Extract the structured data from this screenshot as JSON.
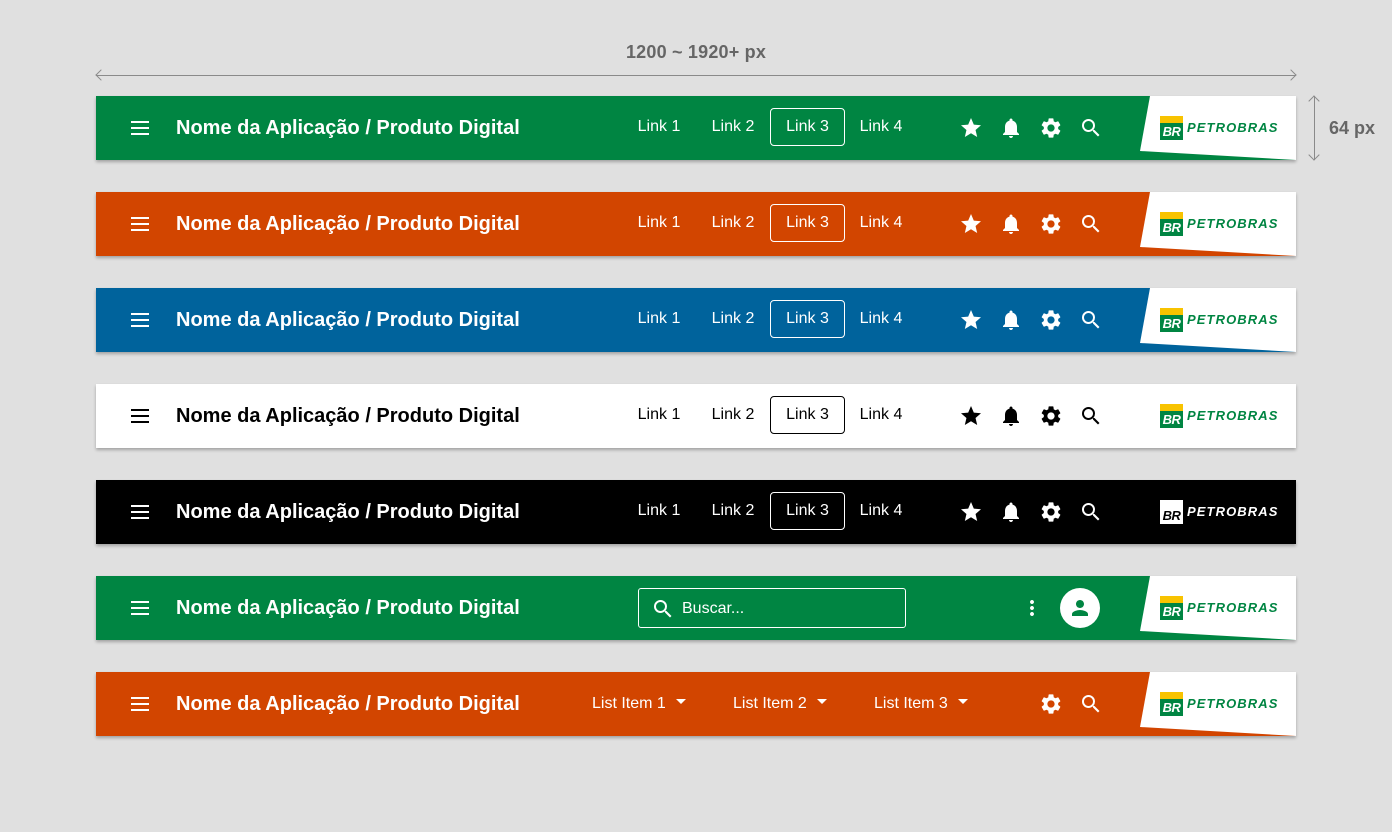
{
  "dimensions": {
    "width_label": "1200 ~ 1920+ px",
    "height_label": "64 px"
  },
  "shared": {
    "title": "Nome da Aplicação / Produto Digital",
    "links": [
      "Link 1",
      "Link 2",
      "Link 3",
      "Link 4"
    ],
    "active_link": "Link 3",
    "logo_br": "BR",
    "logo_word": "PETROBRAS"
  },
  "bars": [
    {
      "variant": "links",
      "background": "#008542",
      "foreground": "#ffffff",
      "logo_style": "white-tab"
    },
    {
      "variant": "links",
      "background": "#d24500",
      "foreground": "#ffffff",
      "logo_style": "white-tab"
    },
    {
      "variant": "links",
      "background": "#00639c",
      "foreground": "#ffffff",
      "logo_style": "white-tab"
    },
    {
      "variant": "links",
      "background": "#ffffff",
      "foreground": "#000000",
      "logo_style": "plain"
    },
    {
      "variant": "links",
      "background": "#000000",
      "foreground": "#ffffff",
      "logo_style": "mono"
    },
    {
      "variant": "search",
      "background": "#008542",
      "foreground": "#ffffff",
      "logo_style": "white-tab",
      "search_placeholder": "Buscar..."
    },
    {
      "variant": "dropdowns",
      "background": "#d24500",
      "foreground": "#ffffff",
      "logo_style": "white-tab",
      "list_items": [
        "List Item 1",
        "List Item 2",
        "List Item 3"
      ]
    }
  ],
  "icons": {
    "menu": "menu-icon",
    "favorite": "star-icon",
    "notifications": "bell-icon",
    "settings": "gear-icon",
    "search": "search-icon",
    "more": "more-vertical-icon",
    "account": "person-icon"
  }
}
